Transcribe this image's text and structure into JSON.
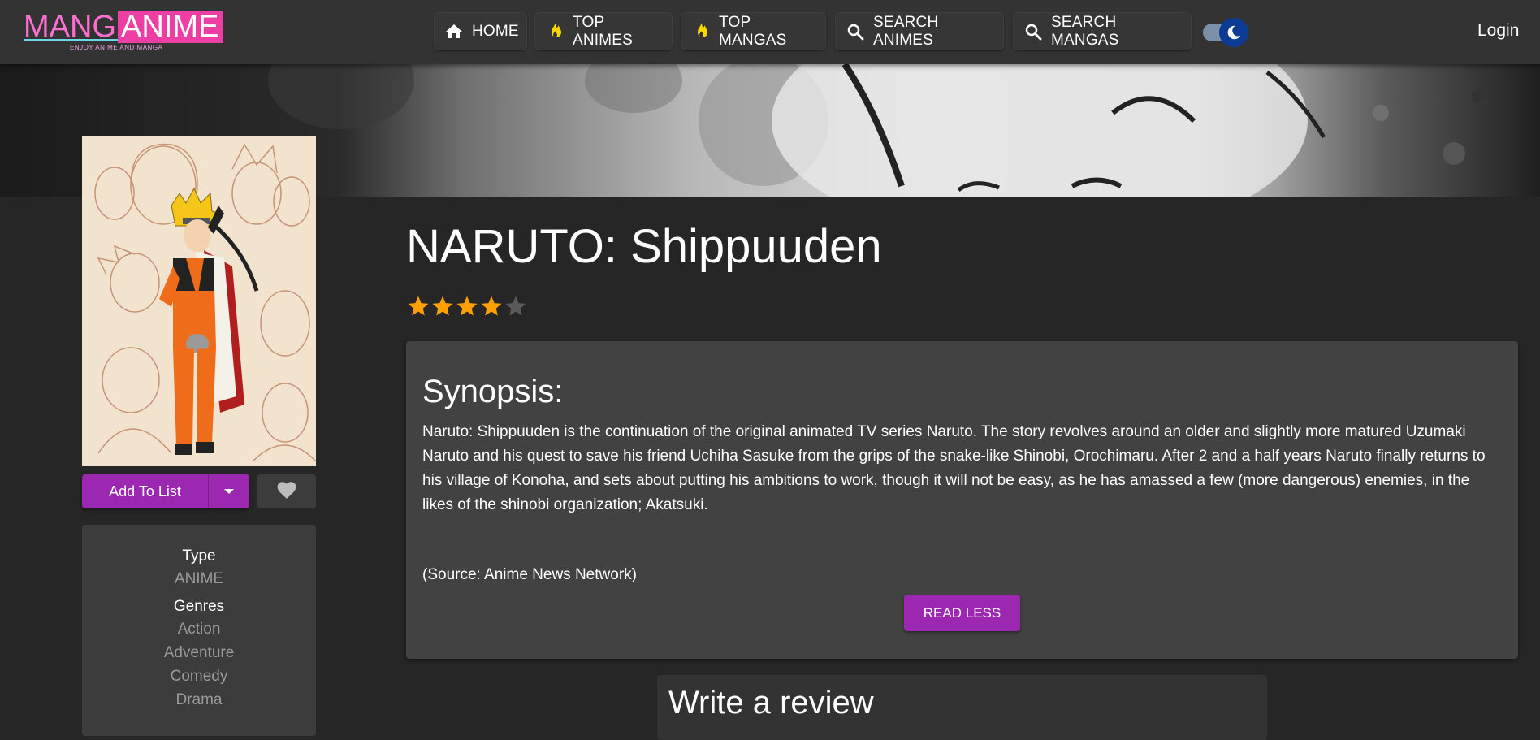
{
  "logo": {
    "part1": "MANG",
    "part2": "ANIME",
    "tagline": "ENJOY ANIME AND MANGA"
  },
  "nav": {
    "home": "HOME",
    "top_animes": "TOP ANIMES",
    "top_mangas": "TOP MANGAS",
    "search_animes": "SEARCH ANIMES",
    "search_mangas": "SEARCH MANGAS",
    "login": "Login"
  },
  "colors": {
    "accent": "#9c27b0",
    "star": "#ffa000",
    "toggle": "#0c3b94",
    "flame": "#ffd600"
  },
  "anime": {
    "title": "NARUTO: Shippuuden",
    "rating_stars": 4,
    "rating_max": 5
  },
  "actions": {
    "add_to_list": "Add To List"
  },
  "info": {
    "type_label": "Type",
    "type_value": "ANIME",
    "genres_label": "Genres",
    "genres": [
      "Action",
      "Adventure",
      "Comedy",
      "Drama"
    ]
  },
  "synopsis": {
    "heading": "Synopsis:",
    "text": "Naruto: Shippuuden is the continuation of the original animated TV series Naruto. The story revolves around an older and slightly more matured Uzumaki Naruto and his quest to save his friend Uchiha Sasuke from the grips of the snake-like Shinobi, Orochimaru. After 2 and a half years Naruto finally returns to his village of Konoha, and sets about putting his ambitions to work, though it will not be easy, as he has amassed a few (more dangerous) enemies, in the likes of the shinobi organization; Akatsuki.",
    "source": "(Source: Anime News Network)",
    "read_less": "READ LESS"
  },
  "review": {
    "heading": "Write a review"
  }
}
